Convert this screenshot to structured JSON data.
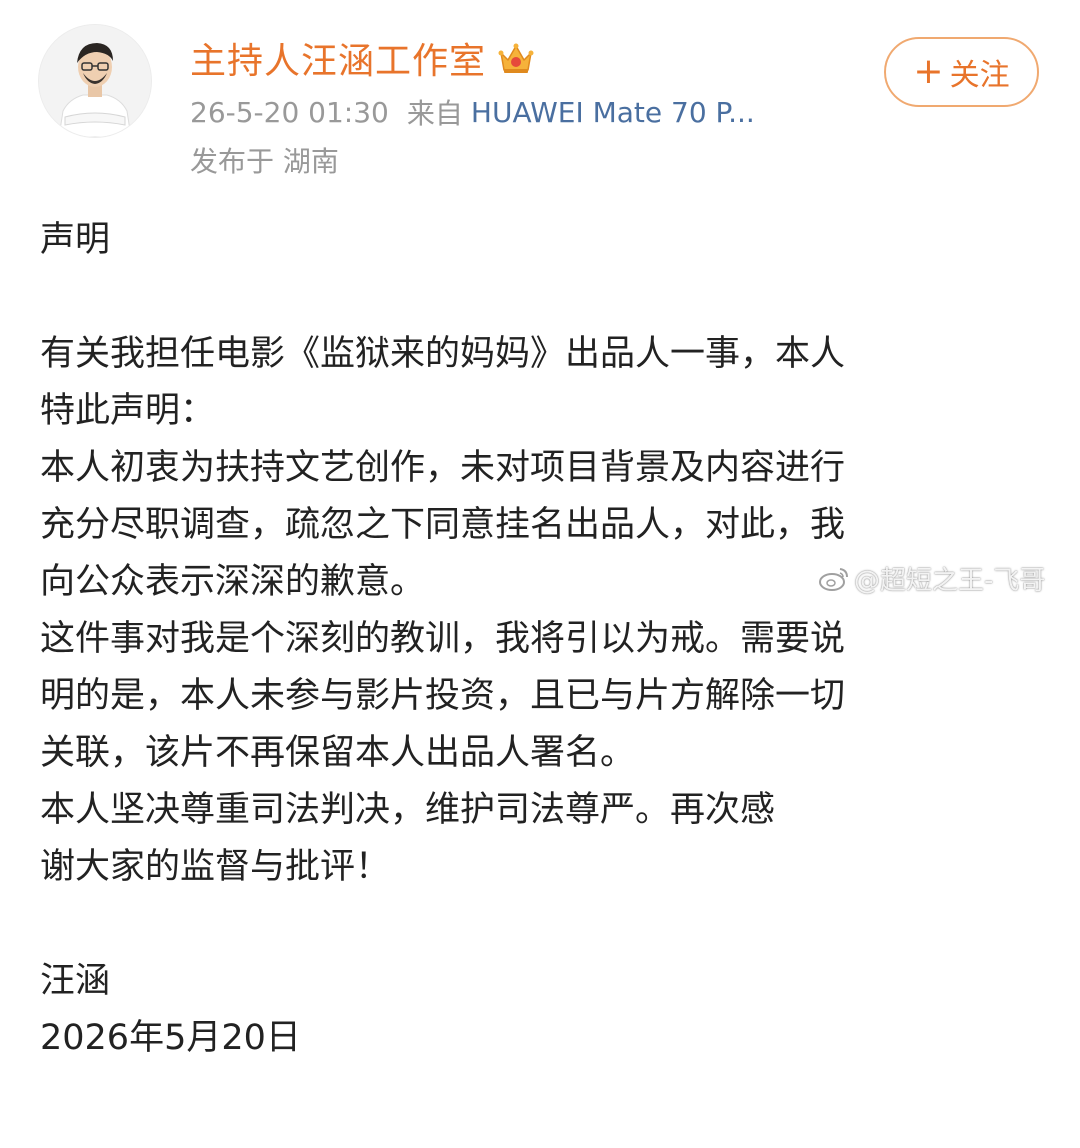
{
  "post": {
    "user_name": "主持人汪涵工作室",
    "time": "26-5-20 01:30",
    "from_label": "来自",
    "device": "HUAWEI Mate 70 P...",
    "location": "发布于 湖南",
    "follow_label": "关注",
    "follow_plus": "+"
  },
  "statement": {
    "lines": [
      "声明",
      "",
      "有关我担任电影《监狱来的妈妈》出品人一事，本人",
      "特此声明：",
      "本人初衷为扶持文艺创作，未对项目背景及内容进行",
      "充分尽职调查，疏忽之下同意挂名出品人，对此，我",
      "向公众表示深深的歉意。",
      "这件事对我是个深刻的教训，我将引以为戒。需要说",
      "明的是，本人未参与影片投资，且已与片方解除一切",
      "关联，该片不再保留本人出品人署名。",
      "本人坚决尊重司法判决，维护司法尊严。再次感",
      "谢大家的监督与批评！",
      "",
      "汪涵",
      "2026年5月20日"
    ]
  },
  "watermark": {
    "text": "@超短之王-飞哥",
    "icon": "weibo-icon"
  },
  "colors": {
    "name": "#e8742b",
    "device_link": "#4a6fa0",
    "meta": "#999999",
    "follow_border": "#f0a970"
  }
}
